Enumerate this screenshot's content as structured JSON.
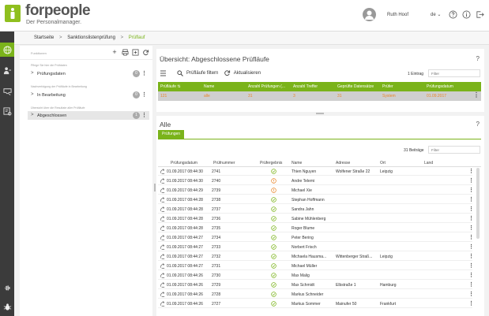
{
  "header": {
    "brand": "forpeople",
    "tagline": "Der Personalmanager.",
    "username": "Ruth Hoof",
    "language": "de",
    "lang_chevron": "⌄"
  },
  "breadcrumb": {
    "items": [
      "Startseite",
      "Sanktionslistenprüfung",
      "Prüflauf"
    ],
    "separator": ">"
  },
  "left_panel": {
    "toolbar_label": "Funktionen",
    "add_symbol": "+",
    "groups": [
      {
        "hint": "Pflege Sie hier die Prüfdaten",
        "label": "Prüfungsdaten",
        "count": "0"
      },
      {
        "hint": "Nachverfolgung der Prüfläufe in Bearbeitung",
        "label": "In Bearbeitung",
        "count": "0"
      },
      {
        "hint": "Übersicht über die Resultate aller Prüfläufe",
        "label": "Abgeschlossen",
        "count": "1"
      }
    ]
  },
  "summary": {
    "title": "Übersicht: Abgeschlossene Prüfläufe",
    "help": "?",
    "filter_button": "Prüfläufe filtern",
    "refresh_button": "Aktualisieren",
    "entry_count": "1 Eintrag",
    "filter_placeholder": "Filter",
    "columns": [
      "Prüfläufe",
      "Name",
      "Anzahl Prüfungen (...",
      "Anzahl Treffer",
      "Geprüfte Datensätze",
      "Prüfer",
      "Prüfungsdatum"
    ],
    "sort_icon": "⇅",
    "row": [
      "121",
      "alle",
      "31",
      "3",
      "31",
      "System",
      "01.09.2017"
    ],
    "kebab": "⋮"
  },
  "all_panel": {
    "title": "Alle",
    "help": "?",
    "tab": "Prüfungen",
    "entry_count": "31 Beiträge",
    "filter_placeholder": "Filter",
    "columns": [
      "Prüfungsdatum",
      "Prüfnummer",
      "Prüfergebnis",
      "Name",
      "Adresse",
      "Ort",
      "Land"
    ],
    "rows": [
      {
        "date": "01.09.2017 08:44:30",
        "num": "2741",
        "result": "ok",
        "name": "Thien Nguyen",
        "addr": "Wolfener Straße 22",
        "ort": "Leipzig",
        "land": ""
      },
      {
        "date": "01.09.2017 08:44:30",
        "num": "2740",
        "result": "warn",
        "name": "Andre Telemi",
        "addr": "",
        "ort": "",
        "land": ""
      },
      {
        "date": "01.09.2017 08:44:29",
        "num": "2739",
        "result": "warn",
        "name": "Michael Xie",
        "addr": "",
        "ort": "",
        "land": ""
      },
      {
        "date": "01.09.2017 08:44:28",
        "num": "2738",
        "result": "ok",
        "name": "Stephan Hoffmann",
        "addr": "",
        "ort": "",
        "land": ""
      },
      {
        "date": "01.09.2017 08:44:28",
        "num": "2737",
        "result": "ok",
        "name": "Sandra Jahn",
        "addr": "",
        "ort": "",
        "land": ""
      },
      {
        "date": "01.09.2017 08:44:28",
        "num": "2736",
        "result": "ok",
        "name": "Sabine Mühlenberg",
        "addr": "",
        "ort": "",
        "land": ""
      },
      {
        "date": "01.09.2017 08:44:28",
        "num": "2735",
        "result": "ok",
        "name": "Roger Blume",
        "addr": "",
        "ort": "",
        "land": ""
      },
      {
        "date": "01.09.2017 08:44:27",
        "num": "2734",
        "result": "ok",
        "name": "Peter Bering",
        "addr": "",
        "ort": "",
        "land": ""
      },
      {
        "date": "01.09.2017 08:44:27",
        "num": "2733",
        "result": "ok",
        "name": "Norbert Frisch",
        "addr": "",
        "ort": "",
        "land": ""
      },
      {
        "date": "01.09.2017 08:44:27",
        "num": "2732",
        "result": "ok",
        "name": "Michaela Hausma...",
        "addr": "Wittenberger Straß...",
        "ort": "Leipzig",
        "land": ""
      },
      {
        "date": "01.09.2017 08:44:27",
        "num": "2731",
        "result": "ok",
        "name": "Michael Müller",
        "addr": "",
        "ort": "",
        "land": ""
      },
      {
        "date": "01.09.2017 08:44:26",
        "num": "2730",
        "result": "ok",
        "name": "Max Malig",
        "addr": "",
        "ort": "",
        "land": ""
      },
      {
        "date": "01.09.2017 08:44:26",
        "num": "2729",
        "result": "ok",
        "name": "Max Schmidt",
        "addr": "Elbstraße 1",
        "ort": "Hamburg",
        "land": ""
      },
      {
        "date": "01.09.2017 08:44:26",
        "num": "2728",
        "result": "ok",
        "name": "Markus Schneider",
        "addr": "",
        "ort": "",
        "land": ""
      },
      {
        "date": "01.09.2017 08:44:26",
        "num": "2727",
        "result": "ok",
        "name": "Markus Sommer",
        "addr": "Mainufer 50",
        "ort": "Frankfurt",
        "land": ""
      }
    ]
  },
  "colors": {
    "accent": "#7ab31a",
    "warn": "#e8862a",
    "rail": "#3b3b3b"
  },
  "icons": {
    "rail": [
      "globe-icon",
      "users-icon",
      "inbox-icon",
      "list-check-icon",
      "gear-icon",
      "bug-icon"
    ],
    "header": [
      "help-icon",
      "info-icon",
      "logout-icon"
    ]
  }
}
